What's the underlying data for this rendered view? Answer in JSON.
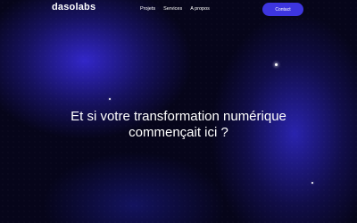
{
  "brand": {
    "logo": "dasolabs"
  },
  "nav": {
    "links": [
      "Projets",
      "Services",
      "A propos"
    ],
    "contact_label": "Contact"
  },
  "hero": {
    "title_line1": "Et si votre transformation numérique",
    "title_line2": "commençait ici ?"
  },
  "colors": {
    "background": "#07061a",
    "accent": "#3d35e0",
    "glow": "#3428d2"
  }
}
